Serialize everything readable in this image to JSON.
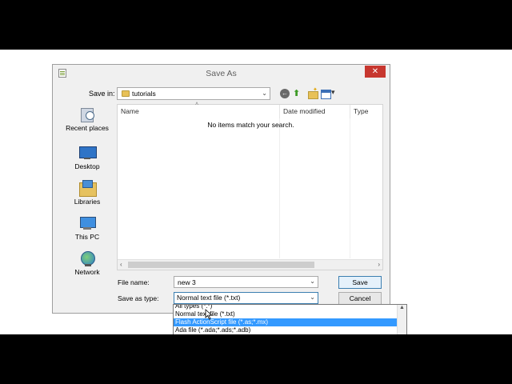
{
  "window": {
    "title": "Save As",
    "close_label": "✕"
  },
  "toolbar": {
    "save_in_label": "Save in:",
    "save_in_value": "tutorials",
    "back_icon": "back-arrow-icon",
    "up_icon": "up-folder-icon",
    "new_folder_icon": "new-folder-icon",
    "view_menu_icon": "view-menu-icon"
  },
  "places": [
    {
      "label": "Recent places",
      "icon": "recent-places-icon"
    },
    {
      "label": "Desktop",
      "icon": "desktop-icon"
    },
    {
      "label": "Libraries",
      "icon": "libraries-icon"
    },
    {
      "label": "This PC",
      "icon": "this-pc-icon"
    },
    {
      "label": "Network",
      "icon": "network-icon"
    }
  ],
  "file_list": {
    "columns": [
      "Name",
      "Date modified",
      "Type"
    ],
    "empty_message": "No items match your search."
  },
  "form": {
    "file_name_label": "File name:",
    "file_name_value": "new  3",
    "save_as_type_label": "Save as type:",
    "save_as_type_value": "Normal text file (*.txt)",
    "save_button": "Save",
    "cancel_button": "Cancel"
  },
  "dropdown": {
    "items": [
      "All types (*.*)",
      "Normal text file (*.txt)",
      "Flash ActionScript file (*.as;*.mx)",
      "Ada file (*.ada;*.ads;*.adb)"
    ],
    "selected_index": 2
  },
  "colors": {
    "close_button": "#c7372f",
    "selection": "#3399ff"
  }
}
